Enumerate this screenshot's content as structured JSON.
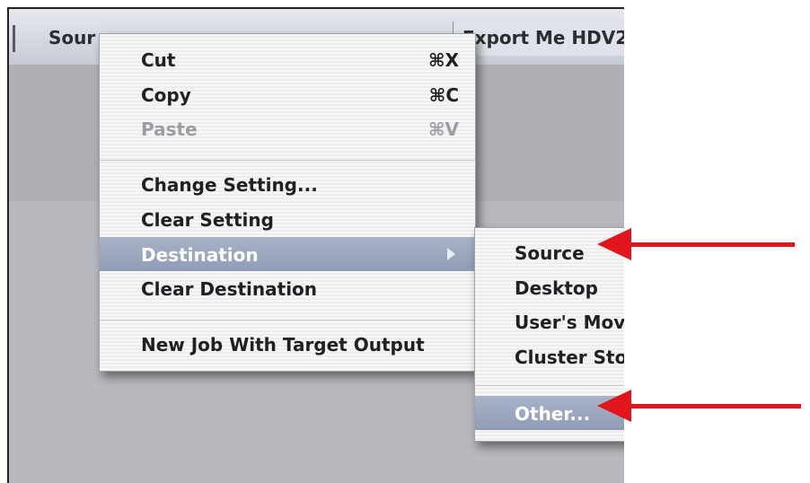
{
  "header": {
    "tab_source": "Sour",
    "tab_export": "Export Me HDV2"
  },
  "context_menu": {
    "items": [
      {
        "label": "Cut",
        "shortcut": "⌘X",
        "enabled": true
      },
      {
        "label": "Copy",
        "shortcut": "⌘C",
        "enabled": true
      },
      {
        "label": "Paste",
        "shortcut": "⌘V",
        "enabled": false
      },
      {
        "label": "Change Setting...",
        "enabled": true
      },
      {
        "label": "Clear Setting",
        "enabled": true
      },
      {
        "label": "Destination",
        "enabled": true,
        "highlighted": true,
        "has_submenu": true
      },
      {
        "label": "Clear Destination",
        "enabled": true
      },
      {
        "label": "New Job With Target Output",
        "enabled": true
      }
    ]
  },
  "destination_submenu": {
    "items": [
      {
        "label": "Source"
      },
      {
        "label": "Desktop"
      },
      {
        "label": "User's Movies"
      },
      {
        "label": "Cluster Storage"
      },
      {
        "label": "Other...",
        "highlighted": true
      }
    ]
  },
  "annotations": {
    "arrow_color": "#e0161c",
    "targets": [
      "Source",
      "Other..."
    ]
  },
  "colors": {
    "menu_highlight": "#97a3bb",
    "menu_text": "#1f1f24",
    "disabled_text": "#9c9ea3",
    "background": "#b1b3b8"
  }
}
